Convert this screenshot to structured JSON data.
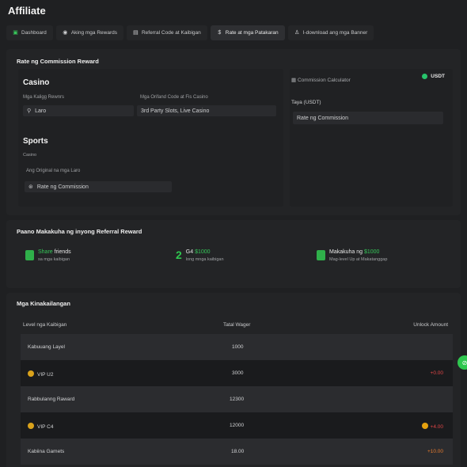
{
  "page": {
    "title": "Affiliate"
  },
  "tabs": [
    {
      "label": "Dashboard",
      "icon": "dashboard-icon"
    },
    {
      "label": "Aking mga Rewards",
      "icon": "pin-icon"
    },
    {
      "label": "Referral Code at Kaibigan",
      "icon": "users-icon"
    },
    {
      "label": "Rate at mga Patakaran",
      "icon": "dollar-icon"
    },
    {
      "label": "I-download ang mga Banner",
      "icon": "person-icon"
    }
  ],
  "commission": {
    "title": "Rate ng Commission Reward",
    "casino_heading": "Casino",
    "label_rewards": "Mga Kaligg Rewnrs",
    "label_referral": "Mga Orifand Code at Fis Casino",
    "field_laro": "Laro",
    "field_slots": "3rd Party Slots, Live Casino",
    "sports_heading": "Sports",
    "sports_sub": "Casino",
    "label_original": "Ang Original na mga Laro",
    "field_rate": "Rate ng Commission",
    "calculator": {
      "title": "Commission Calculator",
      "currency": "USDT",
      "taya_label": "Taya (USDT)",
      "rate_field": "Rate ng Commission"
    }
  },
  "steps": {
    "title": "Paano Makakuha ng inyong Referral Reward",
    "items": [
      {
        "line1_a": "Share",
        "line1_b": " friends",
        "line2": "sa   mga kaibigan"
      },
      {
        "num": "2",
        "line1_a": "G4 ",
        "line1_b": "$1000",
        "line2": "long mnga kaibigan"
      },
      {
        "line1_a": "Makakuha ng ",
        "line1_b": "$1000",
        "line2": "Mag-level Up at Makatanggap"
      }
    ]
  },
  "table": {
    "title": "Mga Kinakailangan",
    "headers": {
      "level": "Level nga Kaibigan",
      "wager": "Tatal Wager",
      "unlock": "Unlock Amount"
    },
    "rows": [
      {
        "level": "Kabuuang Layel",
        "wager": "1000",
        "unlock": ""
      },
      {
        "level": "VIP U2",
        "wager": "3000",
        "unlock": "+0.00"
      },
      {
        "level": "Rabbulanng Raward",
        "wager": "12300",
        "unlock": ""
      },
      {
        "level": "VIP C4",
        "wager": "12000",
        "unlock": "+4.00"
      },
      {
        "level": "Kabiina Gamets",
        "wager": "18.00",
        "unlock": "+10.00"
      }
    ]
  },
  "colors": {
    "accent": "#2fc74f",
    "negative": "#e04646",
    "positive": "#e57a2e"
  }
}
